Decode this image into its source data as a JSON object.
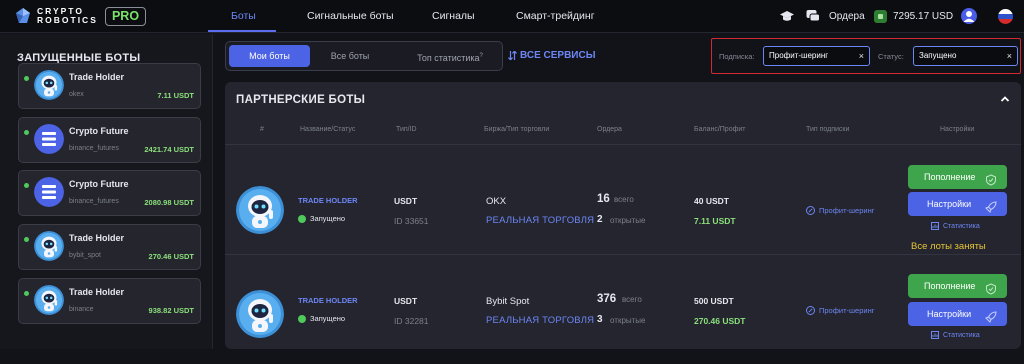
{
  "header": {
    "logo_line1": "CRYPTO",
    "logo_line2": "ROBOTICS",
    "badge": "PRO",
    "nav": [
      "Боты",
      "Сигнальные боты",
      "Сигналы",
      "Смарт-трейдинг"
    ],
    "active_nav": "Боты",
    "orders_label": "Ордера",
    "balance": "7295.17 USD",
    "icons": [
      "graduation-cap-icon",
      "chat-icon",
      "wallet-icon",
      "user-icon",
      "flag-ru-icon"
    ]
  },
  "sidebar": {
    "title": "ЗАПУЩЕННЫЕ БОТЫ",
    "bots": [
      {
        "name": "Trade Holder",
        "exchange": "okex",
        "profit": "7.11 USDT",
        "avatar": "robot"
      },
      {
        "name": "Crypto Future",
        "exchange": "binance_futures",
        "profit": "2421.74 USDT",
        "avatar": "bars"
      },
      {
        "name": "Crypto Future",
        "exchange": "binance_futures",
        "profit": "2080.98 USDT",
        "avatar": "bars"
      },
      {
        "name": "Trade Holder",
        "exchange": "bybit_spot",
        "profit": "270.46 USDT",
        "avatar": "robot"
      },
      {
        "name": "Trade Holder",
        "exchange": "binance",
        "profit": "938.82 USDT",
        "avatar": "robot"
      }
    ]
  },
  "tabs": {
    "my_bots": "Мои боты",
    "all_bots": "Все боты",
    "top_stats": "Топ статистика",
    "top_stats_sup": "?",
    "all_services": "ВСЕ СЕРВИСЫ"
  },
  "filters": {
    "subscription_label": "Подписка:",
    "subscription_value": "Профит-шеринг",
    "status_label": "Статус:",
    "status_value": "Запущено",
    "clear": "×"
  },
  "panel": {
    "title": "ПАРТНЕРСКИЕ БОТЫ",
    "columns": [
      "#",
      "Название/Статус",
      "Тип/ID",
      "Биржа/Тип торговли",
      "Ордера",
      "Баланс/Профит",
      "Тип подписки",
      "Настройки"
    ],
    "rows": [
      {
        "name": "TRADE HOLDER",
        "status": "Запущено",
        "type": "USDT",
        "id": "ID 33651",
        "exchange": "OKX",
        "trade_type": "РЕАЛЬНАЯ ТОРГОВЛЯ",
        "orders_total": "16",
        "orders_total_label": "всего",
        "orders_open": "2",
        "orders_open_label": "открытые",
        "balance": "40 USDT",
        "profit": "7.11 USDT",
        "subscription": "Профит-шеринг",
        "refill": "Пополнение",
        "settings": "Настройки",
        "stats": "Статистика",
        "note": "Все лоты заняты"
      },
      {
        "name": "TRADE HOLDER",
        "status": "Запущено",
        "type": "USDT",
        "id": "ID 32281",
        "exchange": "Bybit Spot",
        "trade_type": "РЕАЛЬНАЯ ТОРГОВЛЯ",
        "orders_total": "376",
        "orders_total_label": "всего",
        "orders_open": "3",
        "orders_open_label": "открытые",
        "balance": "500 USDT",
        "profit": "270.46 USDT",
        "subscription": "Профит-шеринг",
        "refill": "Пополнение",
        "settings": "Настройки",
        "stats": "Статистика"
      }
    ]
  },
  "colors": {
    "accent": "#4c63e6",
    "link": "#6d86f5",
    "green": "#3fa54c",
    "profit": "#8be07b",
    "warning": "#e8c53a",
    "highlight_border": "#d12a35"
  }
}
